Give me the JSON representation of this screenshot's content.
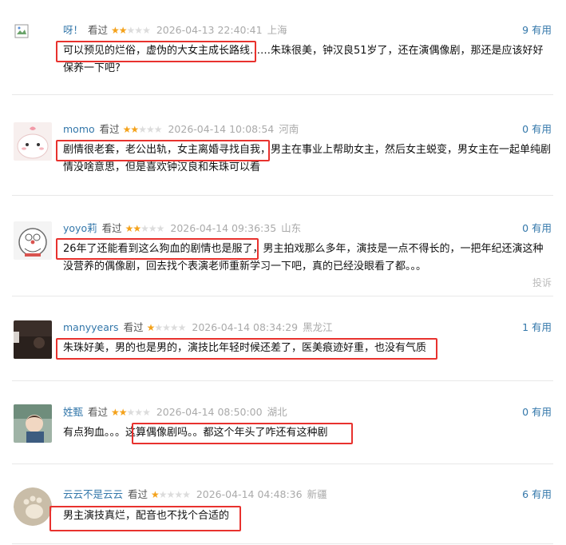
{
  "reviews": [
    {
      "user": "呀！",
      "watched": "看过",
      "rating": 2,
      "date": "2026-04-13 22:40:41",
      "location": "上海",
      "useful": "9 有用",
      "content": "可以预见的烂俗，虚伪的大女主成长路线……朱珠很美，钟汉良51岁了，还在演偶像剧，那还是应该好好保养一下吧?"
    },
    {
      "user": "momo",
      "watched": "看过",
      "rating": 2,
      "date": "2026-04-14 10:08:54",
      "location": "河南",
      "useful": "0 有用",
      "content": "剧情很老套，老公出轨，女主离婚寻找自我，男主在事业上帮助女主，然后女主蜕变，男女主在一起单纯剧情没啥意思，但是喜欢钟汉良和朱珠可以看"
    },
    {
      "user": "yoyo莉",
      "watched": "看过",
      "rating": 2,
      "date": "2026-04-14 09:36:35",
      "location": "山东",
      "useful": "0 有用",
      "content": "26年了还能看到这么狗血的剧情也是服了，男主拍戏那么多年，演技是一点不得长的，一把年纪还演这种没营养的偶像剧，回去找个表演老师重新学习一下吧，真的已经没眼看了都。。。",
      "report": "投诉"
    },
    {
      "user": "manyyears",
      "watched": "看过",
      "rating": 1,
      "date": "2026-04-14 08:34:29",
      "location": "黑龙江",
      "useful": "1 有用",
      "content": "朱珠好美，男的也是男的，演技比年轻时候还差了，医美痕迹好重，也没有气质"
    },
    {
      "user": "姓甄",
      "watched": "看过",
      "rating": 2,
      "date": "2026-04-14 08:50:00",
      "location": "湖北",
      "useful": "0 有用",
      "content": "有点狗血。。。这算偶像剧吗。。都这个年头了咋还有这种剧"
    },
    {
      "user": "云云不是云云",
      "watched": "看过",
      "rating": 1,
      "date": "2026-04-14 04:48:36",
      "location": "新疆",
      "useful": "6 有用",
      "content": "男主演技真烂，配音也不找个合适的"
    }
  ],
  "colors": {
    "link": "#3377aa",
    "star": "#f4a21b",
    "highlight": "#e8322e"
  },
  "icons": [
    "broken-image-icon",
    "pink-creature-avatar",
    "doraemon-avatar",
    "dark-photo-avatar",
    "anime-boy-avatar",
    "cat-paw-avatar"
  ]
}
